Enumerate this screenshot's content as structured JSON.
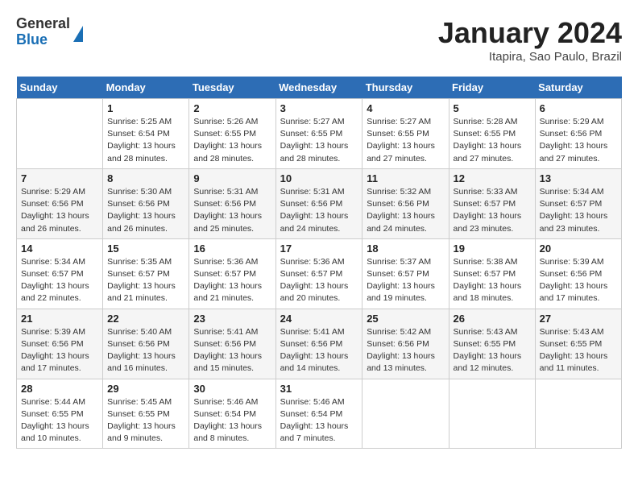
{
  "header": {
    "logo": {
      "general": "General",
      "blue": "Blue"
    },
    "title": "January 2024",
    "location": "Itapira, Sao Paulo, Brazil"
  },
  "days_of_week": [
    "Sunday",
    "Monday",
    "Tuesday",
    "Wednesday",
    "Thursday",
    "Friday",
    "Saturday"
  ],
  "weeks": [
    [
      {
        "day": "",
        "info": ""
      },
      {
        "day": "1",
        "info": "Sunrise: 5:25 AM\nSunset: 6:54 PM\nDaylight: 13 hours and 28 minutes."
      },
      {
        "day": "2",
        "info": "Sunrise: 5:26 AM\nSunset: 6:55 PM\nDaylight: 13 hours and 28 minutes."
      },
      {
        "day": "3",
        "info": "Sunrise: 5:27 AM\nSunset: 6:55 PM\nDaylight: 13 hours and 28 minutes."
      },
      {
        "day": "4",
        "info": "Sunrise: 5:27 AM\nSunset: 6:55 PM\nDaylight: 13 hours and 27 minutes."
      },
      {
        "day": "5",
        "info": "Sunrise: 5:28 AM\nSunset: 6:55 PM\nDaylight: 13 hours and 27 minutes."
      },
      {
        "day": "6",
        "info": "Sunrise: 5:29 AM\nSunset: 6:56 PM\nDaylight: 13 hours and 27 minutes."
      }
    ],
    [
      {
        "day": "7",
        "info": "Sunrise: 5:29 AM\nSunset: 6:56 PM\nDaylight: 13 hours and 26 minutes."
      },
      {
        "day": "8",
        "info": "Sunrise: 5:30 AM\nSunset: 6:56 PM\nDaylight: 13 hours and 26 minutes."
      },
      {
        "day": "9",
        "info": "Sunrise: 5:31 AM\nSunset: 6:56 PM\nDaylight: 13 hours and 25 minutes."
      },
      {
        "day": "10",
        "info": "Sunrise: 5:31 AM\nSunset: 6:56 PM\nDaylight: 13 hours and 24 minutes."
      },
      {
        "day": "11",
        "info": "Sunrise: 5:32 AM\nSunset: 6:56 PM\nDaylight: 13 hours and 24 minutes."
      },
      {
        "day": "12",
        "info": "Sunrise: 5:33 AM\nSunset: 6:57 PM\nDaylight: 13 hours and 23 minutes."
      },
      {
        "day": "13",
        "info": "Sunrise: 5:34 AM\nSunset: 6:57 PM\nDaylight: 13 hours and 23 minutes."
      }
    ],
    [
      {
        "day": "14",
        "info": "Sunrise: 5:34 AM\nSunset: 6:57 PM\nDaylight: 13 hours and 22 minutes."
      },
      {
        "day": "15",
        "info": "Sunrise: 5:35 AM\nSunset: 6:57 PM\nDaylight: 13 hours and 21 minutes."
      },
      {
        "day": "16",
        "info": "Sunrise: 5:36 AM\nSunset: 6:57 PM\nDaylight: 13 hours and 21 minutes."
      },
      {
        "day": "17",
        "info": "Sunrise: 5:36 AM\nSunset: 6:57 PM\nDaylight: 13 hours and 20 minutes."
      },
      {
        "day": "18",
        "info": "Sunrise: 5:37 AM\nSunset: 6:57 PM\nDaylight: 13 hours and 19 minutes."
      },
      {
        "day": "19",
        "info": "Sunrise: 5:38 AM\nSunset: 6:57 PM\nDaylight: 13 hours and 18 minutes."
      },
      {
        "day": "20",
        "info": "Sunrise: 5:39 AM\nSunset: 6:56 PM\nDaylight: 13 hours and 17 minutes."
      }
    ],
    [
      {
        "day": "21",
        "info": "Sunrise: 5:39 AM\nSunset: 6:56 PM\nDaylight: 13 hours and 17 minutes."
      },
      {
        "day": "22",
        "info": "Sunrise: 5:40 AM\nSunset: 6:56 PM\nDaylight: 13 hours and 16 minutes."
      },
      {
        "day": "23",
        "info": "Sunrise: 5:41 AM\nSunset: 6:56 PM\nDaylight: 13 hours and 15 minutes."
      },
      {
        "day": "24",
        "info": "Sunrise: 5:41 AM\nSunset: 6:56 PM\nDaylight: 13 hours and 14 minutes."
      },
      {
        "day": "25",
        "info": "Sunrise: 5:42 AM\nSunset: 6:56 PM\nDaylight: 13 hours and 13 minutes."
      },
      {
        "day": "26",
        "info": "Sunrise: 5:43 AM\nSunset: 6:55 PM\nDaylight: 13 hours and 12 minutes."
      },
      {
        "day": "27",
        "info": "Sunrise: 5:43 AM\nSunset: 6:55 PM\nDaylight: 13 hours and 11 minutes."
      }
    ],
    [
      {
        "day": "28",
        "info": "Sunrise: 5:44 AM\nSunset: 6:55 PM\nDaylight: 13 hours and 10 minutes."
      },
      {
        "day": "29",
        "info": "Sunrise: 5:45 AM\nSunset: 6:55 PM\nDaylight: 13 hours and 9 minutes."
      },
      {
        "day": "30",
        "info": "Sunrise: 5:46 AM\nSunset: 6:54 PM\nDaylight: 13 hours and 8 minutes."
      },
      {
        "day": "31",
        "info": "Sunrise: 5:46 AM\nSunset: 6:54 PM\nDaylight: 13 hours and 7 minutes."
      },
      {
        "day": "",
        "info": ""
      },
      {
        "day": "",
        "info": ""
      },
      {
        "day": "",
        "info": ""
      }
    ]
  ]
}
